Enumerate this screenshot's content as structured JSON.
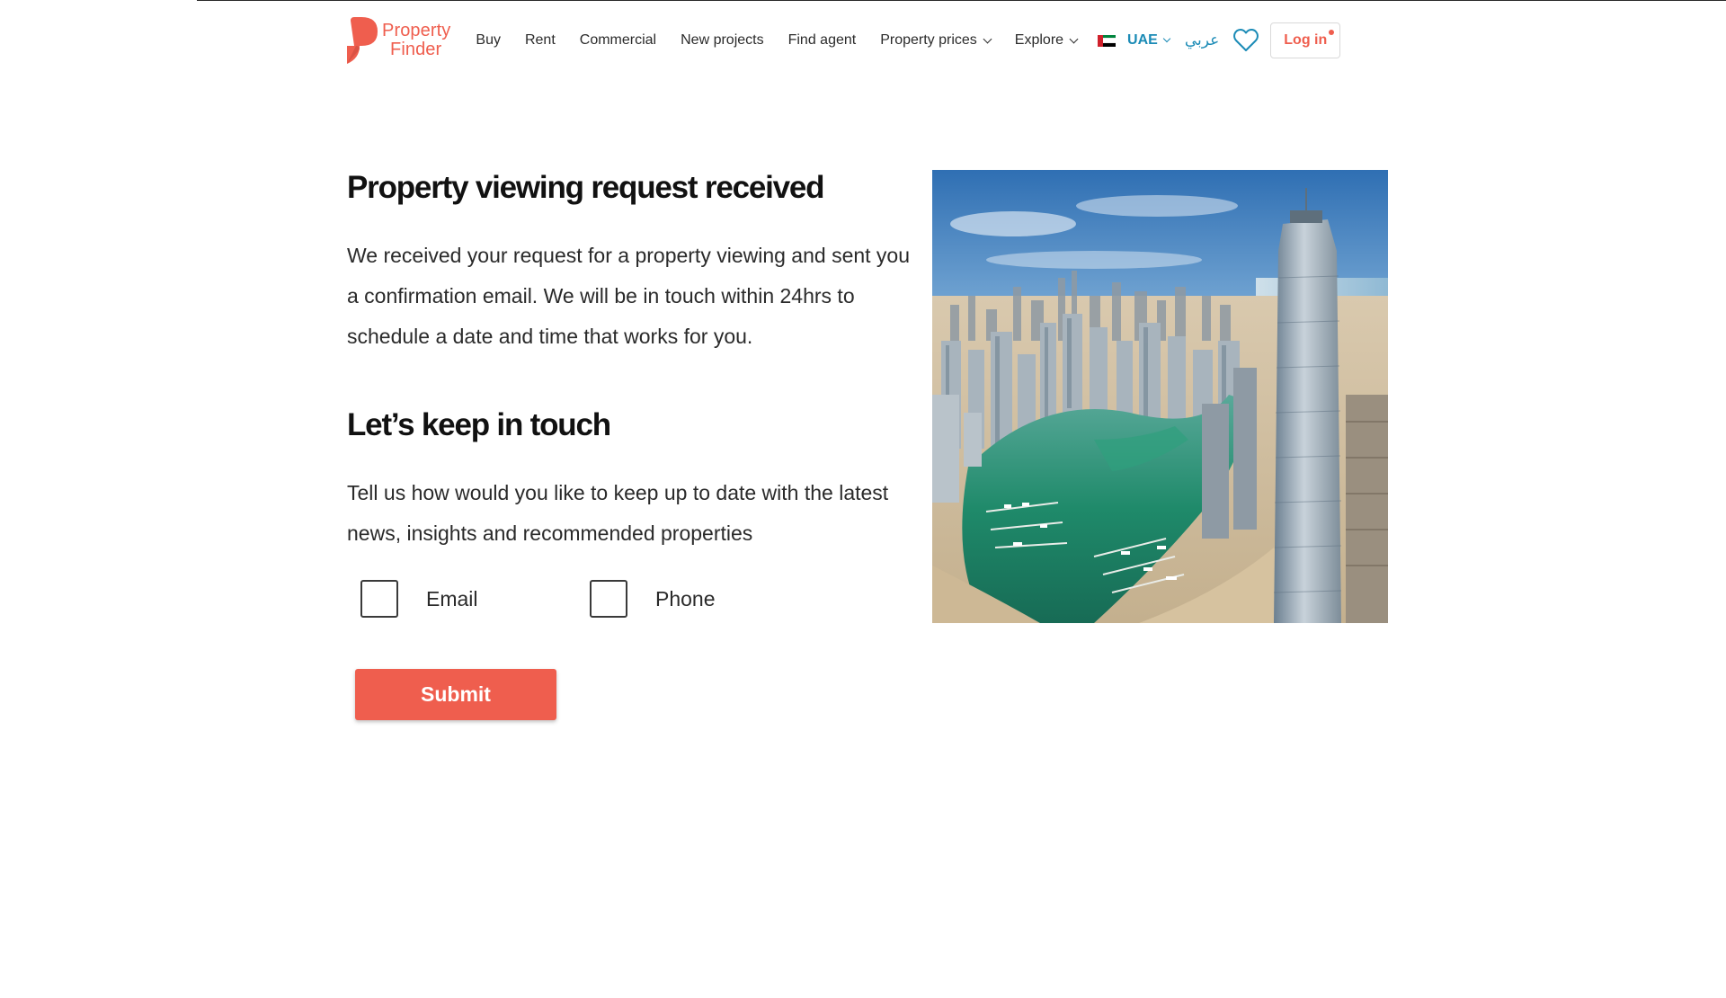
{
  "colors": {
    "brand": "#ef5e4e",
    "link_blue": "#1b8bb6",
    "text": "#2a2a2a"
  },
  "header": {
    "logo": {
      "line1": "Property",
      "line2": "Finder"
    },
    "nav": [
      {
        "label": "Buy",
        "has_dropdown": false
      },
      {
        "label": "Rent",
        "has_dropdown": false
      },
      {
        "label": "Commercial",
        "has_dropdown": false
      },
      {
        "label": "New projects",
        "has_dropdown": false
      },
      {
        "label": "Find agent",
        "has_dropdown": false
      },
      {
        "label": "Property prices",
        "has_dropdown": true
      },
      {
        "label": "Explore",
        "has_dropdown": true
      }
    ],
    "country": "UAE",
    "language_toggle": "عربي",
    "favorites_icon": "heart-icon",
    "login_label": "Log in"
  },
  "main": {
    "title": "Property viewing request received",
    "body": "We received your request for a property viewing and sent you a confirmation email. We will be in touch within 24hrs to schedule a date and time that works for you.",
    "keep_in_touch_title": "Let’s keep in touch",
    "keep_in_touch_body": "Tell us how would you like to keep up to date with the latest news, insights and recommended properties",
    "options": [
      {
        "label": "Email",
        "checked": false
      },
      {
        "label": "Phone",
        "checked": false
      }
    ],
    "submit_label": "Submit"
  }
}
